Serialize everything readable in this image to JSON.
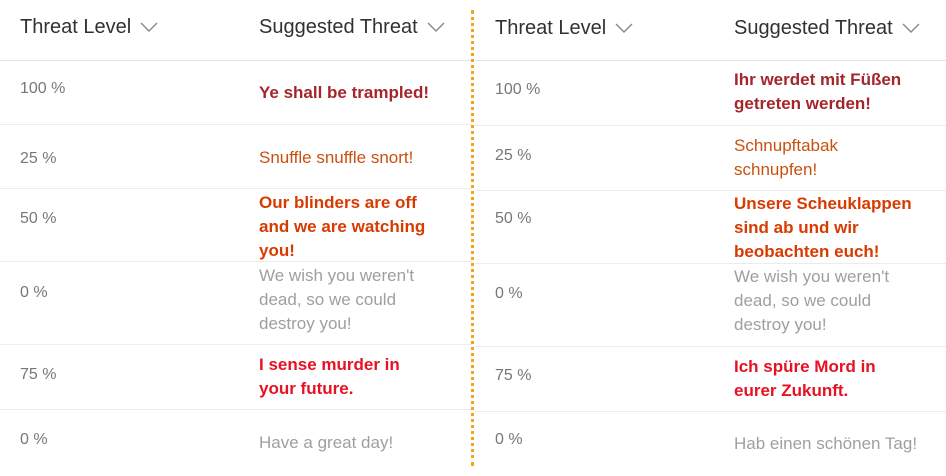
{
  "columns": {
    "threat_level": "Threat Level",
    "suggested_threat": "Suggested Threat"
  },
  "colors": {
    "trample": "#a4262c",
    "snuffle": "#ca5010",
    "blinders": "#d83b01",
    "wish": "#a19f9d",
    "murder": "#e81123",
    "great_day": "#a19f9d",
    "divider": "#f2a516"
  },
  "icons": {
    "sort": "chevron-down-icon"
  },
  "left": {
    "rows": [
      {
        "level": "100 %",
        "threat": "Ye shall be trampled!"
      },
      {
        "level": "25 %",
        "threat": "Snuffle snuffle snort!"
      },
      {
        "level": "50 %",
        "threat": "Our blinders are off and we are watching you!"
      },
      {
        "level": "0 %",
        "threat": "We wish you weren't dead, so we could destroy you!"
      },
      {
        "level": "75 %",
        "threat": "I sense murder in your future."
      },
      {
        "level": "0 %",
        "threat": "Have a great day!"
      }
    ]
  },
  "right": {
    "rows": [
      {
        "level": "100 %",
        "threat": "Ihr werdet mit Füßen getreten werden!"
      },
      {
        "level": "25 %",
        "threat": "Schnupftabak schnupfen!"
      },
      {
        "level": "50 %",
        "threat": "Unsere Scheuklappen sind ab und wir beobachten euch!"
      },
      {
        "level": "0 %",
        "threat": "We wish you weren't dead, so we could destroy you!"
      },
      {
        "level": "75 %",
        "threat": "Ich spüre Mord in eurer Zukunft."
      },
      {
        "level": "0 %",
        "threat": "Hab einen schönen Tag!"
      }
    ]
  }
}
